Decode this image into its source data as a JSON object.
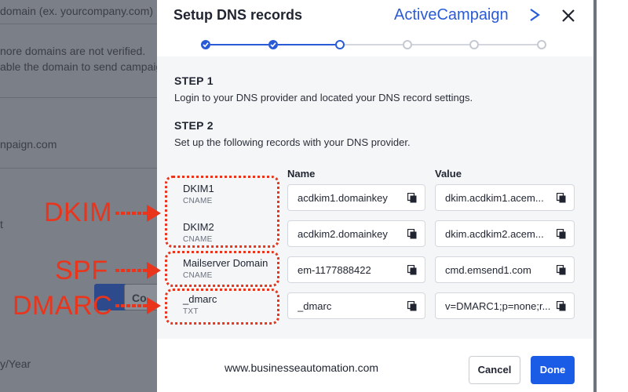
{
  "background_page": {
    "domain_placeholder": "domain (ex. yourcompany.com)",
    "warning_line1": "nore domains are not verified.",
    "warning_line2": "able the domain to send campaig",
    "domain_entry": "npaign.com",
    "letter_t": "t",
    "button_fragment": "Co",
    "date_format": "y/Year"
  },
  "modal": {
    "title": "Setup DNS records",
    "brand": "ActiveCampaign",
    "close_glyph": "✕",
    "stepper": {
      "total_steps": 6,
      "completed_steps": 2,
      "current_step": 3
    },
    "step1": {
      "heading": "STEP 1",
      "description": "Login to your DNS provider and located your DNS record settings."
    },
    "step2": {
      "heading": "STEP 2",
      "description": "Set up the following records with your DNS provider."
    },
    "columns": {
      "name": "Name",
      "value": "Value"
    },
    "records": [
      {
        "label": "DKIM1",
        "type": "CNAME",
        "name": "acdkim1.domainkey",
        "value": "dkim.acdkim1.acem..."
      },
      {
        "label": "DKIM2",
        "type": "CNAME",
        "name": "acdkim2.domainkey",
        "value": "dkim.acdkim2.acem..."
      },
      {
        "label": "Mailserver Domain",
        "type": "CNAME",
        "name": "em-1177888422",
        "value": "cmd.emsend1.com"
      },
      {
        "label": "_dmarc",
        "type": "TXT",
        "name": "_dmarc",
        "value": "v=DMARC1;p=none;r..."
      }
    ],
    "footer": {
      "watermark": "www.businesseautomation.com",
      "cancel_label": "Cancel",
      "done_label": "Done"
    }
  },
  "annotations": {
    "dkim": "DKIM",
    "spf": "SPF",
    "dmarc": "DMARC"
  },
  "colors": {
    "accent": "#2a5bd7",
    "primary_button": "#1b5ce6",
    "annotation_red": "#e8351c",
    "backdrop": "#7b7f88"
  }
}
